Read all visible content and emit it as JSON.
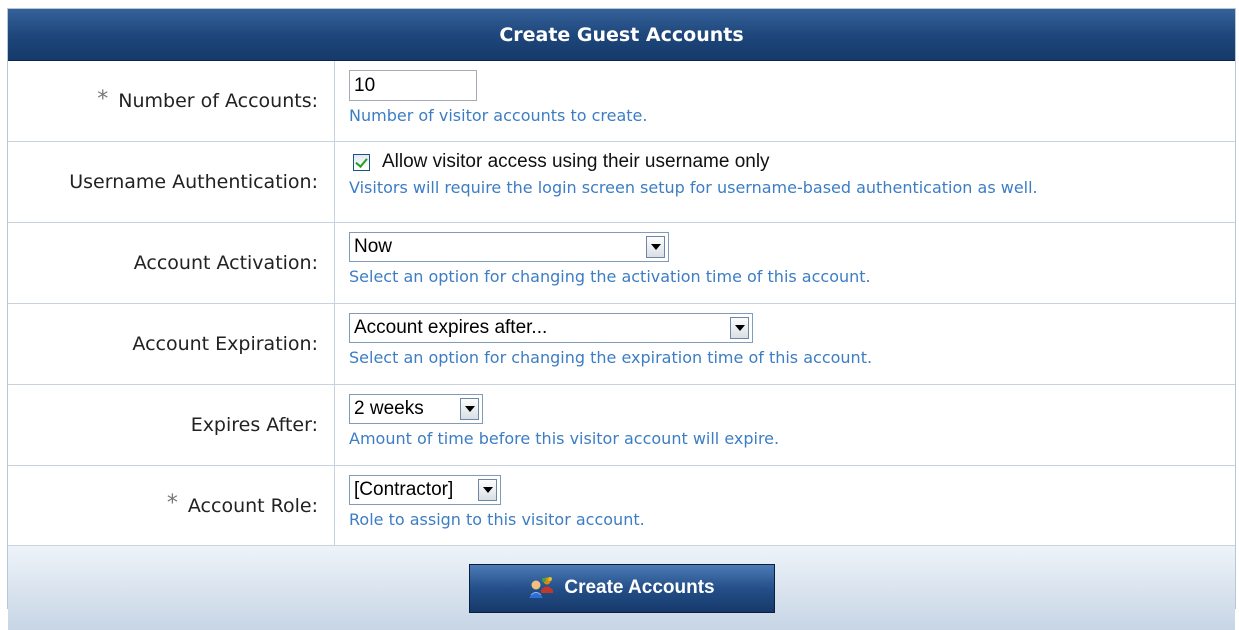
{
  "form": {
    "title": "Create Guest Accounts",
    "rows": {
      "num_accounts": {
        "required": true,
        "label": "Number of Accounts:",
        "value": "10",
        "hint": "Number of visitor accounts to create."
      },
      "username_auth": {
        "label": "Username Authentication:",
        "checked": true,
        "checkbox_label": "Allow visitor access using their username only",
        "hint": "Visitors will require the login screen setup for username-based authentication as well."
      },
      "activation": {
        "label": "Account Activation:",
        "selected": "Now",
        "hint": "Select an option for changing the activation time of this account."
      },
      "expiration": {
        "label": "Account Expiration:",
        "selected": "Account expires after...",
        "hint": "Select an option for changing the expiration time of this account."
      },
      "expires_after": {
        "label": "Expires After:",
        "selected": "2 weeks",
        "hint": "Amount of time before this visitor account will expire."
      },
      "role": {
        "required": true,
        "label": "Account Role:",
        "selected": "[Contractor]",
        "hint": "Role to assign to this visitor account."
      }
    },
    "required_marker": "*",
    "submit": {
      "label": "Create Accounts",
      "icon": "users-group-icon"
    }
  },
  "colors": {
    "header": "#1f477c",
    "hint_text": "#3c7dc4",
    "border": "#c8d3df",
    "footer": "#c7d5e5"
  }
}
